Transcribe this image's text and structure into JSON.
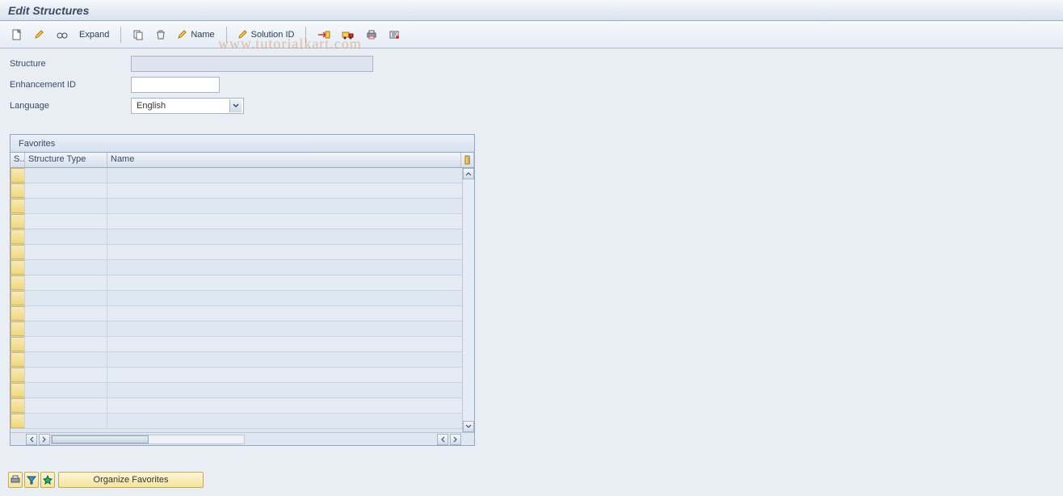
{
  "title": "Edit Structures",
  "watermark": "www.tutorialkart.com",
  "toolbar": {
    "expand_label": "Expand",
    "name_label": "Name",
    "solution_label": "Solution ID"
  },
  "form": {
    "structure_label": "Structure",
    "structure_value": "",
    "enhancement_label": "Enhancement ID",
    "enhancement_value": "",
    "language_label": "Language",
    "language_value": "English"
  },
  "table": {
    "title": "Favorites",
    "columns": {
      "sel": "S..",
      "type": "Structure Type",
      "name": "Name"
    },
    "rows": [
      {
        "type": "",
        "name": ""
      },
      {
        "type": "",
        "name": ""
      },
      {
        "type": "",
        "name": ""
      },
      {
        "type": "",
        "name": ""
      },
      {
        "type": "",
        "name": ""
      },
      {
        "type": "",
        "name": ""
      },
      {
        "type": "",
        "name": ""
      },
      {
        "type": "",
        "name": ""
      },
      {
        "type": "",
        "name": ""
      },
      {
        "type": "",
        "name": ""
      },
      {
        "type": "",
        "name": ""
      },
      {
        "type": "",
        "name": ""
      },
      {
        "type": "",
        "name": ""
      },
      {
        "type": "",
        "name": ""
      },
      {
        "type": "",
        "name": ""
      },
      {
        "type": "",
        "name": ""
      },
      {
        "type": "",
        "name": ""
      }
    ]
  },
  "bottom": {
    "organize_label": "Organize Favorites"
  }
}
